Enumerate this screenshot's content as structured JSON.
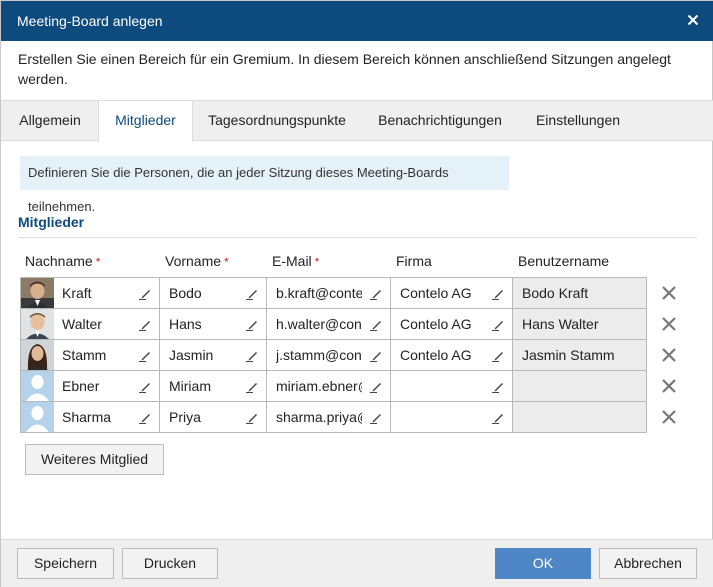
{
  "dialog": {
    "title": "Meeting-Board anlegen",
    "description": "Erstellen Sie einen Bereich für ein Gremium. In diesem Bereich können anschließend Sitzungen angelegt werden."
  },
  "tabs": [
    {
      "label": "Allgemein",
      "active": false
    },
    {
      "label": "Mitglieder",
      "active": true
    },
    {
      "label": "Tagesordnungspunkte",
      "active": false
    },
    {
      "label": "Benachrichtigungen",
      "active": false
    },
    {
      "label": "Einstellungen",
      "active": false
    }
  ],
  "info_text": "Definieren Sie die Personen, die an jeder Sitzung dieses Meeting-Boards teilnehmen.",
  "section_title": "Mitglieder",
  "columns": {
    "nachname": "Nachname",
    "vorname": "Vorname",
    "email": "E-Mail",
    "firma": "Firma",
    "benutzername": "Benutzername",
    "required_marker": "*"
  },
  "members": [
    {
      "nachname": "Kraft",
      "vorname": "Bodo",
      "email": "b.kraft@contelo.de",
      "firma": "Contelo AG",
      "benutzername": "Bodo Kraft",
      "avatar": "photo-man-dark"
    },
    {
      "nachname": "Walter",
      "vorname": "Hans",
      "email": "h.walter@contelo.de",
      "firma": "Contelo AG",
      "benutzername": "Hans Walter",
      "avatar": "photo-man-light"
    },
    {
      "nachname": "Stamm",
      "vorname": "Jasmin",
      "email": "j.stamm@contelo.de",
      "firma": "Contelo AG",
      "benutzername": "Jasmin Stamm",
      "avatar": "photo-woman"
    },
    {
      "nachname": "Ebner",
      "vorname": "Miriam",
      "email": "miriam.ebner@",
      "firma": "",
      "benutzername": "",
      "avatar": "placeholder-avatar"
    },
    {
      "nachname": "Sharma",
      "vorname": "Priya",
      "email": "sharma.priya@",
      "firma": "",
      "benutzername": "",
      "avatar": "placeholder-avatar"
    }
  ],
  "buttons": {
    "add_member": "Weiteres Mitglied",
    "save": "Speichern",
    "print": "Drucken",
    "ok": "OK",
    "cancel": "Abbrechen"
  },
  "icons": {
    "close": "close-icon",
    "edit": "pencil-icon",
    "delete": "delete-x-icon"
  },
  "colors": {
    "titlebar": "#0d4a7d",
    "accent": "#0d4a7d",
    "primary_button": "#4f86c6",
    "info_background": "#e4f1f9",
    "required": "#c0282d"
  }
}
